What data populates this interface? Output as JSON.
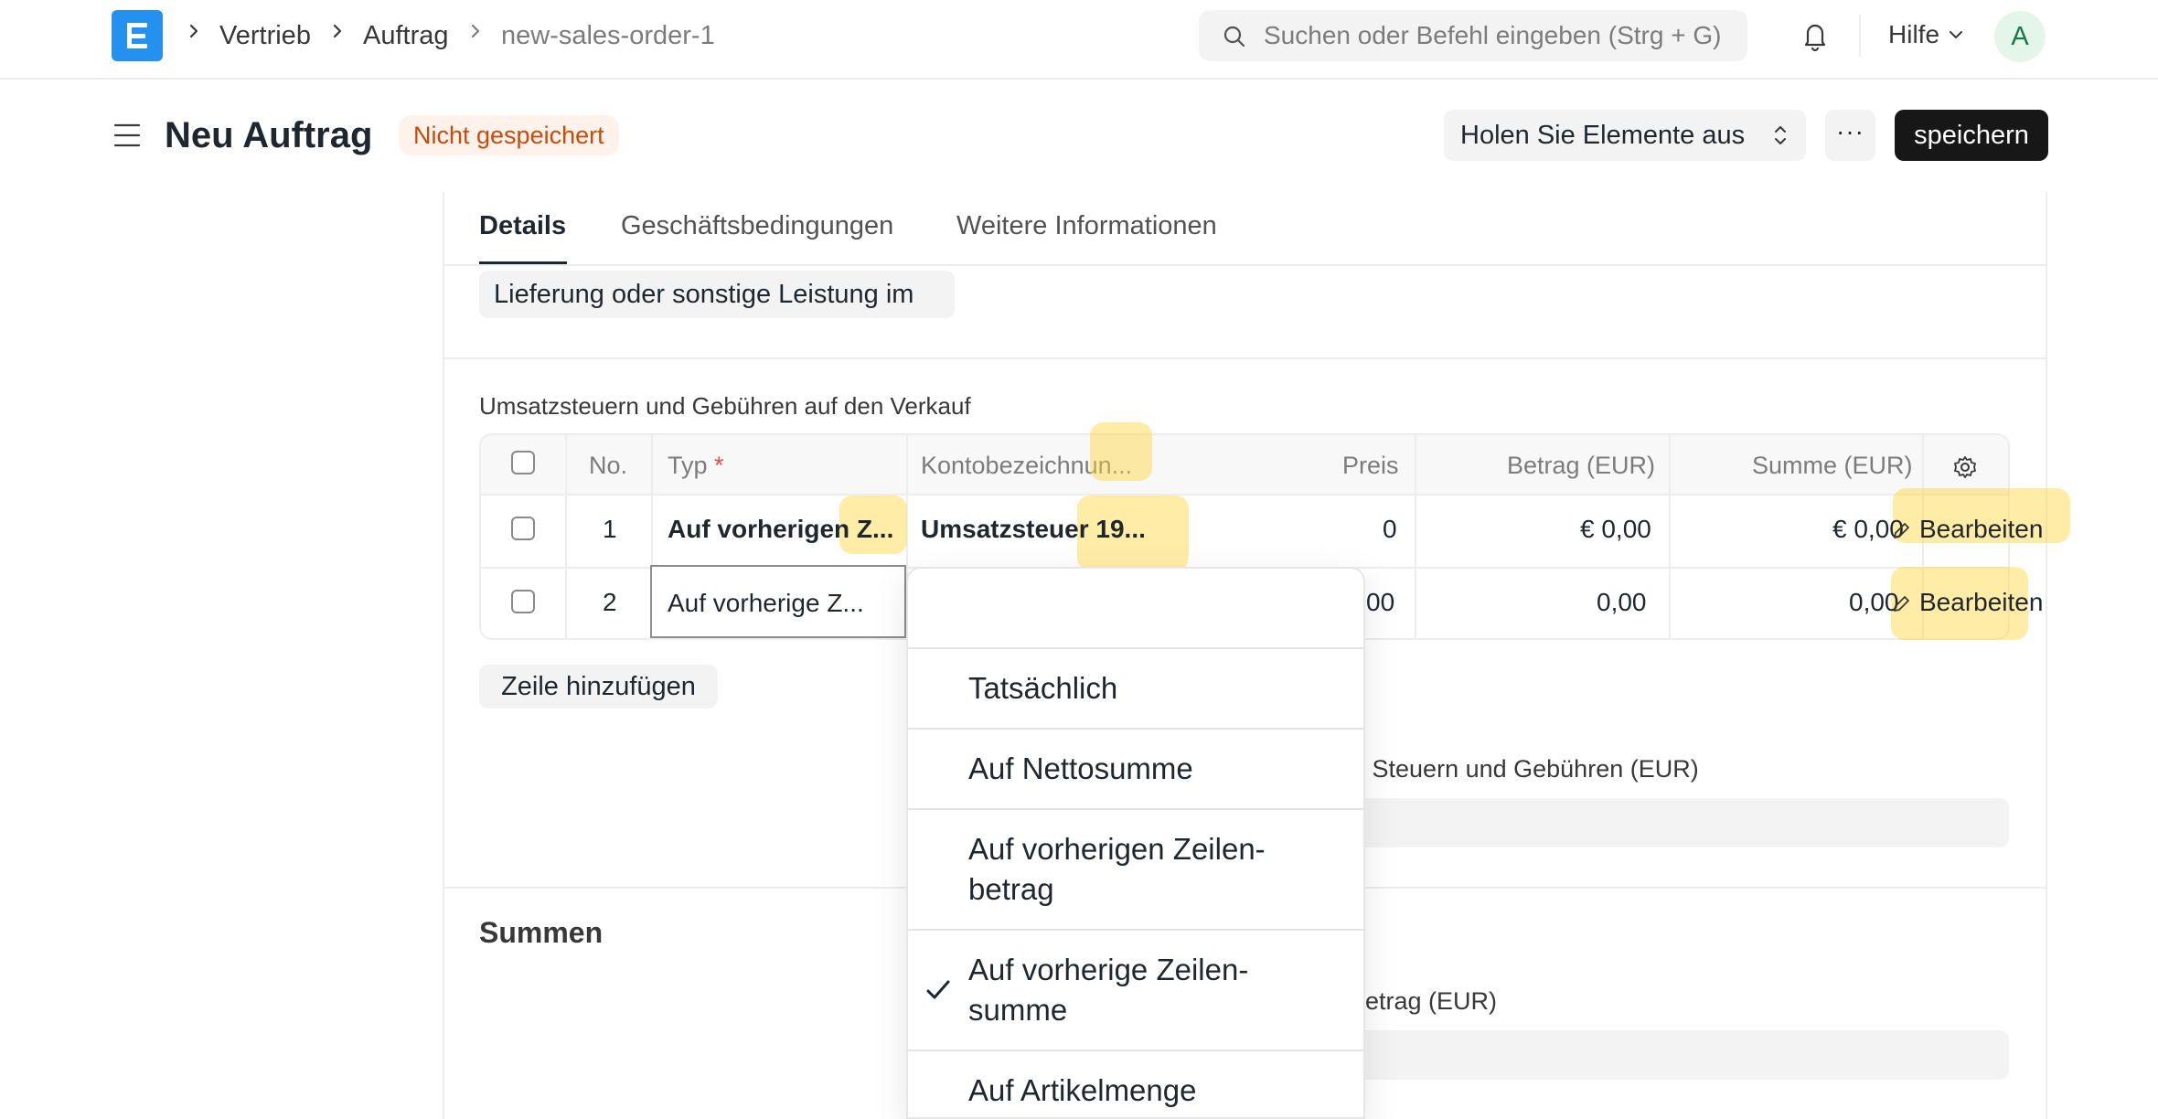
{
  "navbar": {
    "breadcrumbs": [
      "Vertrieb",
      "Auftrag",
      "new-sales-order-1"
    ],
    "search_placeholder": "Suchen oder Befehl eingeben (Strg + G)",
    "help_label": "Hilfe",
    "avatar_initial": "A"
  },
  "page": {
    "title": "Neu Auftrag",
    "status": "Nicht gespeichert",
    "get_items_label": "Holen Sie Elemente aus",
    "more_label": "···",
    "save_label": "speichern"
  },
  "tabs": [
    {
      "label": "Details",
      "active": true
    },
    {
      "label": "Geschäftsbedingungen",
      "active": false
    },
    {
      "label": "Weitere Informationen",
      "active": false
    }
  ],
  "supply_field_value": "Lieferung oder sonstige Leistung im",
  "taxes": {
    "section_label": "Umsatzsteuern und Gebühren auf den Verkauf",
    "columns": {
      "no": "No.",
      "type": "Typ",
      "type_required": "*",
      "account": "Kontobezeichnun...",
      "rate": "Preis",
      "amount": "Betrag (EUR)",
      "total": "Summe (EUR)"
    },
    "rows": [
      {
        "no": "1",
        "type": "Auf vorherigen Z...",
        "account": "Umsatzsteuer 19...",
        "rate": "0",
        "amount": "€ 0,00",
        "total": "€ 0,00",
        "edit": "Bearbeiten"
      },
      {
        "no": "2",
        "type": "Auf vorherige Z...",
        "account": "",
        "rate": "00",
        "amount": "0,00",
        "total": "0,00",
        "edit": "Bearbeiten"
      }
    ],
    "add_row_label": "Zeile hinzufügen",
    "total_taxes_label": "e Steuern und Gebühren (EUR)"
  },
  "totals": {
    "title": "Summen",
    "amount_label": "betrag (EUR)"
  },
  "dropdown": {
    "options": [
      "",
      "Tatsächlich",
      "Auf Nettosumme",
      "Auf vorherigen Zeilen-betrag",
      "Auf vorherige Zeilen-summe",
      "Auf Artikelmenge"
    ],
    "selected": "Auf vorherige Zeilen-summe"
  },
  "colors": {
    "accent": "#2490ef",
    "status_bg": "#fff2ea",
    "status_text": "#c94b0c",
    "primary_button": "#171717",
    "highlight": "#ffd63c"
  }
}
